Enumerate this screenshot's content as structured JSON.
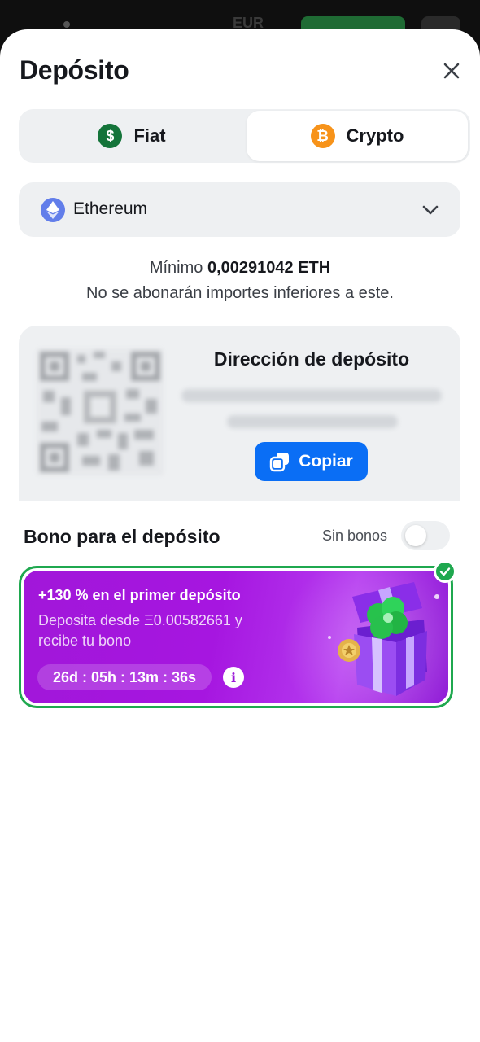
{
  "background": {
    "currency": "EUR"
  },
  "header": {
    "title": "Depósito"
  },
  "tabs": [
    {
      "label": "Fiat",
      "icon": "dollar-coin-icon",
      "selected": false
    },
    {
      "label": "Crypto",
      "icon": "bitcoin-icon",
      "selected": true
    }
  ],
  "network_select": {
    "label": "Ethereum",
    "icon": "ethereum-icon"
  },
  "minimum": {
    "prefix": "Mínimo",
    "amount": "0,00291042 ETH",
    "note": "No se abonarán importes inferiores a este."
  },
  "address": {
    "title": "Dirección de depósito",
    "copy_label": "Copiar"
  },
  "bonus": {
    "title": "Bono para el depósito",
    "no_bonus_label": "Sin bonos",
    "toggle_on": false,
    "card": {
      "headline": "+130 % en el primer depósito",
      "description": "Deposita desde Ξ0.00582661 y recibe tu bono",
      "timer": "26d : 05h : 13m : 36s",
      "selected": true
    }
  },
  "colors": {
    "accent_blue": "#0a6ef5",
    "success_green": "#1fa84f",
    "bonus_purple": "#a616e0",
    "ethereum": "#627eea",
    "bitcoin": "#f7931a"
  }
}
